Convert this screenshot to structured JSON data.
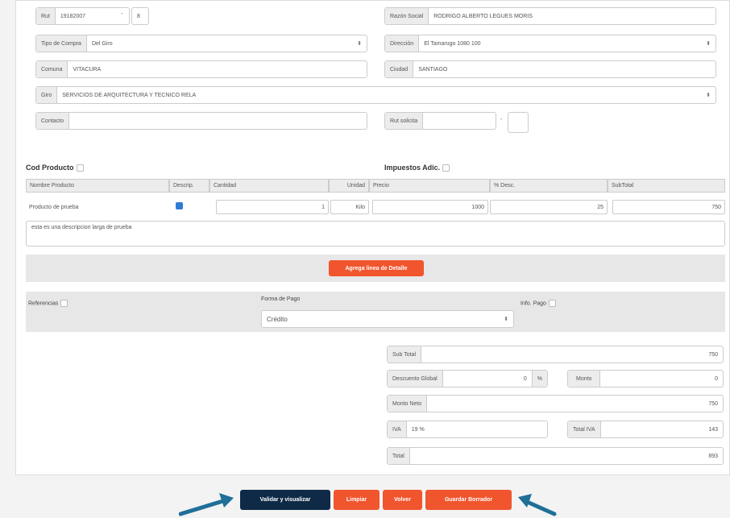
{
  "header_fields": {
    "rut_label": "Rut",
    "rut_value": "19182007",
    "rut_dash": "-",
    "rut_dv": "8",
    "razon_social_label": "Razón Social",
    "razon_social_value": "RODRIGO ALBERTO LEGUES MORIS",
    "tipo_compra_label": "Tipo de Compra",
    "tipo_compra_value": "Del Giro",
    "direccion_label": "Dirección",
    "direccion_value": "El Tamarugo 1080 100",
    "comuna_label": "Comuna",
    "comuna_value": "VITACURA",
    "ciudad_label": "Ciudad",
    "ciudad_value": "SANTIAGO",
    "giro_label": "Giro",
    "giro_value": "SERVICIOS DE ARQUITECTURA Y TECNICO RELA",
    "contacto_label": "Contacto",
    "contacto_value": "",
    "rut_solicita_label": "Rut solicita",
    "rut_solicita_value": "",
    "rut_solicita_dash": "-",
    "rut_solicita_dv": ""
  },
  "detail": {
    "cod_producto_label": "Cod Producto",
    "impuestos_label": "Impuestos Adic.",
    "columns": [
      "Nombre Producto",
      "Descrip.",
      "Cantidad",
      "Unidad",
      "Precio",
      "% Desc.",
      "SubTotal"
    ],
    "row": {
      "nombre": "Producto de prueba",
      "cantidad": "1",
      "unidad": "Kilo",
      "precio": "1000",
      "desc": "25",
      "subtotal": "750"
    },
    "description_text": "esta es una descripcion larga de prueba",
    "add_line_label": "Agrega linea de Detalle"
  },
  "payment": {
    "referencias_label": "Referencias",
    "forma_pago_label": "Forma de Pago",
    "forma_pago_value": "Crédito",
    "info_pago_label": "Info. Pago"
  },
  "totals": {
    "subtotal_label": "Sub Total",
    "subtotal_value": "750",
    "descuento_label": "Descuento Global",
    "descuento_value": "0",
    "descuento_unit": "%",
    "monto_label": "Monto",
    "monto_value": "0",
    "neto_label": "Monto Neto",
    "neto_value": "750",
    "iva_label": "IVA",
    "iva_rate": "19 %",
    "total_iva_label": "Total IVA",
    "total_iva_value": "143",
    "total_label": "Total",
    "total_value": "893"
  },
  "actions": {
    "validar": "Validar y visualizar",
    "limpiar": "Limpiar",
    "volver": "Volver",
    "guardar": "Guardar Borrador"
  },
  "colors": {
    "accent": "#f0552e",
    "primary": "#0f2a46",
    "arrow": "#1f6f98"
  }
}
